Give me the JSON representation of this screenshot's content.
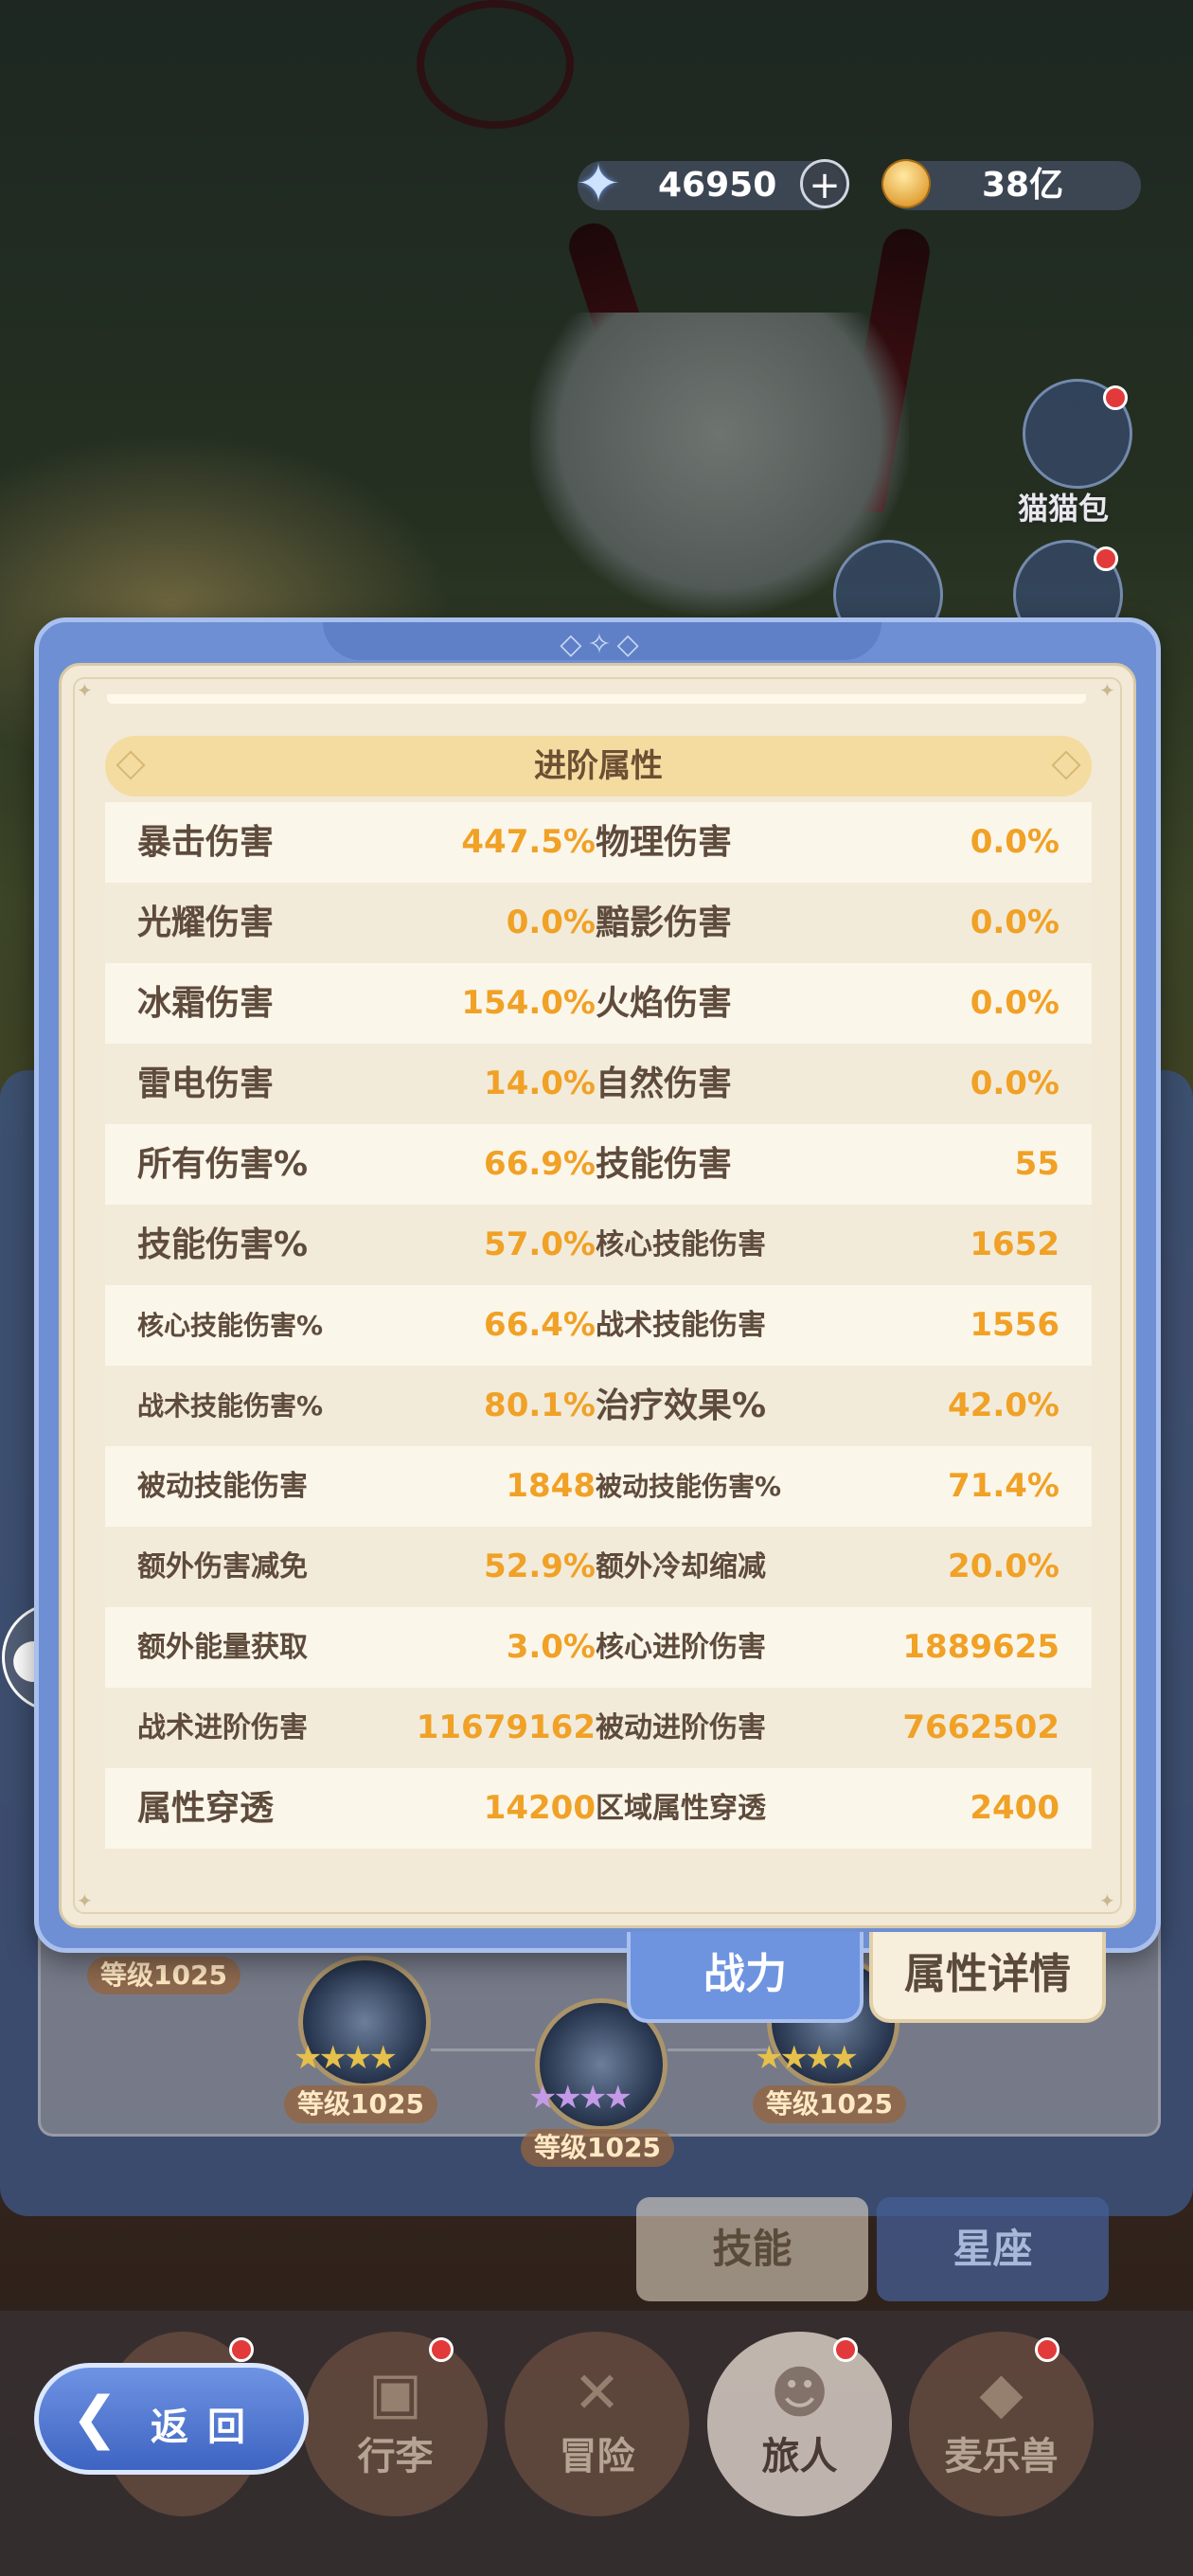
{
  "currency": {
    "gems": "46950",
    "gold": "38亿",
    "gem_icon": "star-gem-icon",
    "gold_icon": "gold-coin-icon"
  },
  "side": {
    "catbag_label": "猫猫包"
  },
  "modal": {
    "section_title": "进阶属性",
    "stats": [
      {
        "left": {
          "name": "暴击伤害",
          "value": "447.5%"
        },
        "right": {
          "name": "物理伤害",
          "value": "0.0%"
        }
      },
      {
        "left": {
          "name": "光耀伤害",
          "value": "0.0%"
        },
        "right": {
          "name": "黯影伤害",
          "value": "0.0%"
        }
      },
      {
        "left": {
          "name": "冰霜伤害",
          "value": "154.0%"
        },
        "right": {
          "name": "火焰伤害",
          "value": "0.0%"
        }
      },
      {
        "left": {
          "name": "雷电伤害",
          "value": "14.0%"
        },
        "right": {
          "name": "自然伤害",
          "value": "0.0%"
        }
      },
      {
        "left": {
          "name": "所有伤害%",
          "value": "66.9%"
        },
        "right": {
          "name": "技能伤害",
          "value": "55"
        }
      },
      {
        "left": {
          "name": "技能伤害%",
          "value": "57.0%"
        },
        "right": {
          "name": "核心技能伤害",
          "value": "1652"
        }
      },
      {
        "left": {
          "name": "核心技能伤害%",
          "value": "66.4%"
        },
        "right": {
          "name": "战术技能伤害",
          "value": "1556"
        }
      },
      {
        "left": {
          "name": "战术技能伤害%",
          "value": "80.1%"
        },
        "right": {
          "name": "治疗效果%",
          "value": "42.0%"
        }
      },
      {
        "left": {
          "name": "被动技能伤害",
          "value": "1848"
        },
        "right": {
          "name": "被动技能伤害%",
          "value": "71.4%"
        }
      },
      {
        "left": {
          "name": "额外伤害减免",
          "value": "52.9%"
        },
        "right": {
          "name": "额外冷却缩减",
          "value": "20.0%"
        }
      },
      {
        "left": {
          "name": "额外能量获取",
          "value": "3.0%"
        },
        "right": {
          "name": "核心进阶伤害",
          "value": "1889625"
        }
      },
      {
        "left": {
          "name": "战术进阶伤害",
          "value": "11679162"
        },
        "right": {
          "name": "被动进阶伤害",
          "value": "7662502"
        }
      },
      {
        "left": {
          "name": "属性穿透",
          "value": "14200"
        },
        "right": {
          "name": "区域属性穿透",
          "value": "2400"
        }
      }
    ],
    "tabs": {
      "power": "战力",
      "detail": "属性详情"
    }
  },
  "background": {
    "levels": [
      "等级1025",
      "等级1025",
      "等级1025",
      "等级1025"
    ],
    "tabs": {
      "skill": "技能",
      "constellation": "星座"
    }
  },
  "nav": {
    "back": "返回",
    "items": [
      "行李",
      "冒险",
      "旅人",
      "麦乐兽"
    ],
    "active": "旅人"
  }
}
